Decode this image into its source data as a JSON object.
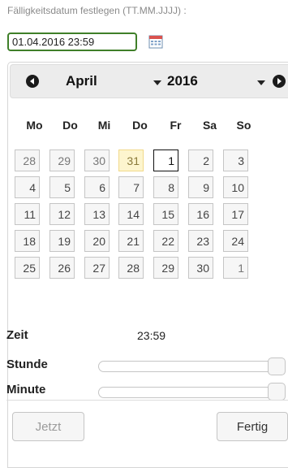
{
  "field": {
    "label": "Fälligkeitsdatum festlegen (TT.MM.JJJJ) :",
    "value": "01.04.2016 23:59"
  },
  "icons": {
    "trigger": "calendar-icon",
    "prev": "circle-triangle-west-icon",
    "next": "circle-triangle-east-icon"
  },
  "picker": {
    "month": "April",
    "year": "2016",
    "weekdays": [
      "Mo",
      "Do",
      "Mi",
      "Do",
      "Fr",
      "Sa",
      "So"
    ],
    "weeks": [
      [
        "28",
        "29",
        "30",
        "31",
        "1",
        "2",
        "3"
      ],
      [
        "4",
        "5",
        "6",
        "7",
        "8",
        "9",
        "10"
      ],
      [
        "11",
        "12",
        "13",
        "14",
        "15",
        "16",
        "17"
      ],
      [
        "18",
        "19",
        "20",
        "21",
        "22",
        "23",
        "24"
      ],
      [
        "25",
        "26",
        "27",
        "28",
        "29",
        "30",
        "1"
      ]
    ],
    "today": "31",
    "selected": "1"
  },
  "time": {
    "label": "Zeit",
    "value": "23:59",
    "hour_label": "Stunde",
    "minute_label": "Minute",
    "hour_level": 1.0,
    "minute_level": 1.0
  },
  "buttons": {
    "now": "Jetzt",
    "done": "Fertig"
  },
  "colors": {
    "input_border": "#3f7f29",
    "today_bg": "#fdf5ce",
    "widget_bg": "#f6f6f6"
  }
}
